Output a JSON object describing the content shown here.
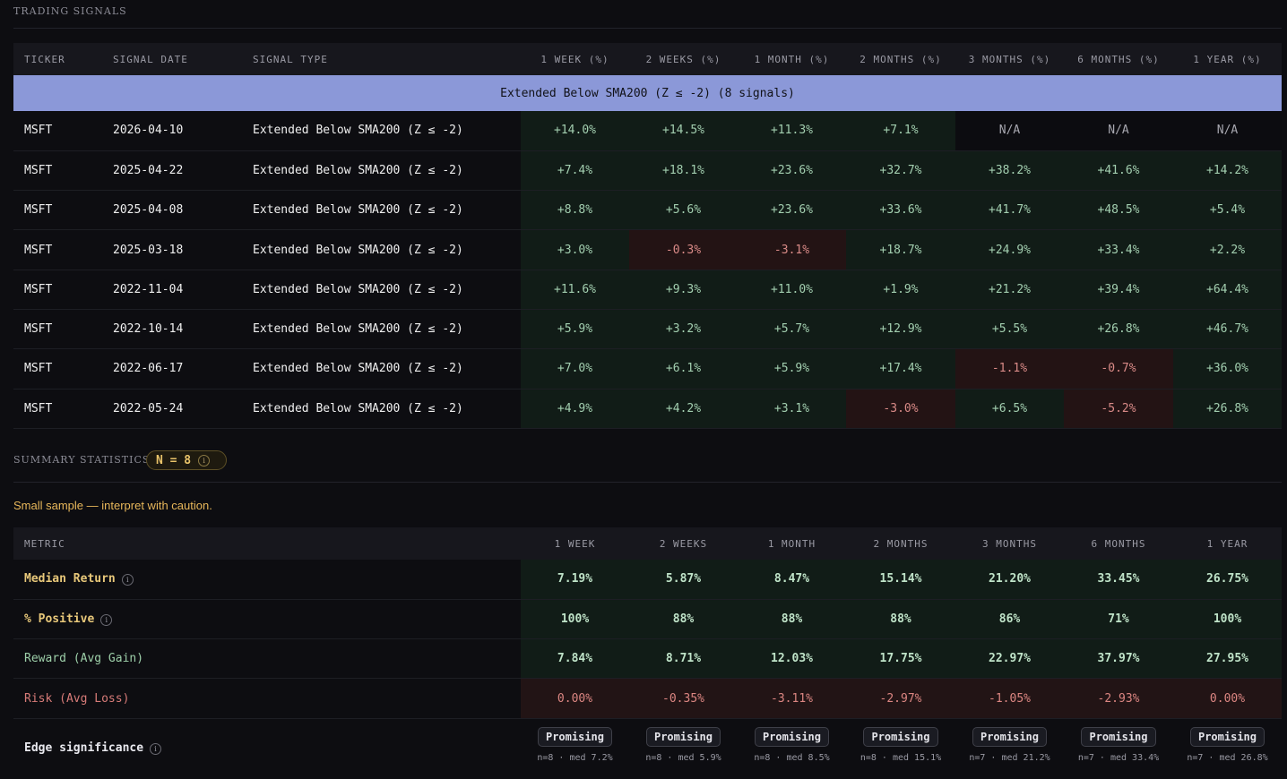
{
  "header": {
    "title": "TRADING SIGNALS"
  },
  "signals": {
    "columns": [
      "TICKER",
      "SIGNAL DATE",
      "SIGNAL TYPE",
      "1 WEEK (%)",
      "2 WEEKS (%)",
      "1 MONTH (%)",
      "2 MONTHS (%)",
      "3 MONTHS (%)",
      "6 MONTHS (%)",
      "1 YEAR (%)"
    ],
    "group_label": "Extended Below SMA200 (Z ≤ -2) (8 signals)",
    "rows": [
      {
        "ticker": "MSFT",
        "date": "2026-04-10",
        "type": "Extended Below SMA200 (Z ≤ -2)",
        "values": [
          "+14.0%",
          "+14.5%",
          "+11.3%",
          "+7.1%",
          "N/A",
          "N/A",
          "N/A"
        ]
      },
      {
        "ticker": "MSFT",
        "date": "2025-04-22",
        "type": "Extended Below SMA200 (Z ≤ -2)",
        "values": [
          "+7.4%",
          "+18.1%",
          "+23.6%",
          "+32.7%",
          "+38.2%",
          "+41.6%",
          "+14.2%"
        ]
      },
      {
        "ticker": "MSFT",
        "date": "2025-04-08",
        "type": "Extended Below SMA200 (Z ≤ -2)",
        "values": [
          "+8.8%",
          "+5.6%",
          "+23.6%",
          "+33.6%",
          "+41.7%",
          "+48.5%",
          "+5.4%"
        ]
      },
      {
        "ticker": "MSFT",
        "date": "2025-03-18",
        "type": "Extended Below SMA200 (Z ≤ -2)",
        "values": [
          "+3.0%",
          "-0.3%",
          "-3.1%",
          "+18.7%",
          "+24.9%",
          "+33.4%",
          "+2.2%"
        ]
      },
      {
        "ticker": "MSFT",
        "date": "2022-11-04",
        "type": "Extended Below SMA200 (Z ≤ -2)",
        "values": [
          "+11.6%",
          "+9.3%",
          "+11.0%",
          "+1.9%",
          "+21.2%",
          "+39.4%",
          "+64.4%"
        ]
      },
      {
        "ticker": "MSFT",
        "date": "2022-10-14",
        "type": "Extended Below SMA200 (Z ≤ -2)",
        "values": [
          "+5.9%",
          "+3.2%",
          "+5.7%",
          "+12.9%",
          "+5.5%",
          "+26.8%",
          "+46.7%"
        ]
      },
      {
        "ticker": "MSFT",
        "date": "2022-06-17",
        "type": "Extended Below SMA200 (Z ≤ -2)",
        "values": [
          "+7.0%",
          "+6.1%",
          "+5.9%",
          "+17.4%",
          "-1.1%",
          "-0.7%",
          "+36.0%"
        ]
      },
      {
        "ticker": "MSFT",
        "date": "2022-05-24",
        "type": "Extended Below SMA200 (Z ≤ -2)",
        "values": [
          "+4.9%",
          "+4.2%",
          "+3.1%",
          "-3.0%",
          "+6.5%",
          "-5.2%",
          "+26.8%"
        ]
      }
    ]
  },
  "summary": {
    "title": "SUMMARY STATISTICS",
    "badge": "N = 8",
    "info_glyph": "i",
    "caution": "Small sample — interpret with caution.",
    "columns": [
      "METRIC",
      "1 WEEK",
      "2 WEEKS",
      "1 MONTH",
      "2 MONTHS",
      "3 MONTHS",
      "6 MONTHS",
      "1 YEAR"
    ],
    "metrics": [
      {
        "label": "Median Return",
        "values": [
          "7.19%",
          "5.87%",
          "8.47%",
          "15.14%",
          "21.20%",
          "33.45%",
          "26.75%"
        ]
      },
      {
        "label": "% Positive",
        "values": [
          "100%",
          "88%",
          "88%",
          "88%",
          "86%",
          "71%",
          "100%"
        ]
      },
      {
        "label": "Reward (Avg Gain)",
        "values": [
          "7.84%",
          "8.71%",
          "12.03%",
          "17.75%",
          "22.97%",
          "37.97%",
          "27.95%"
        ]
      },
      {
        "label": "Risk (Avg Loss)",
        "values": [
          "0.00%",
          "-0.35%",
          "-3.11%",
          "-2.97%",
          "-1.05%",
          "-2.93%",
          "0.00%"
        ]
      }
    ],
    "edge": {
      "label": "Edge significance",
      "items": [
        {
          "verdict": "Promising",
          "detail": "n=8 · med 7.2%"
        },
        {
          "verdict": "Promising",
          "detail": "n=8 · med 5.9%"
        },
        {
          "verdict": "Promising",
          "detail": "n=8 · med 8.5%"
        },
        {
          "verdict": "Promising",
          "detail": "n=8 · med 15.1%"
        },
        {
          "verdict": "Promising",
          "detail": "n=7 · med 21.2%"
        },
        {
          "verdict": "Promising",
          "detail": "n=7 · med 33.4%"
        },
        {
          "verdict": "Promising",
          "detail": "n=7 · med 26.8%"
        }
      ]
    }
  },
  "colors": {
    "background": "#0d0d11",
    "group_banner": "#8b98d8",
    "positive_text": "#a3cfb0",
    "negative_text": "#d98a87",
    "caution_text": "#e8b75a"
  }
}
